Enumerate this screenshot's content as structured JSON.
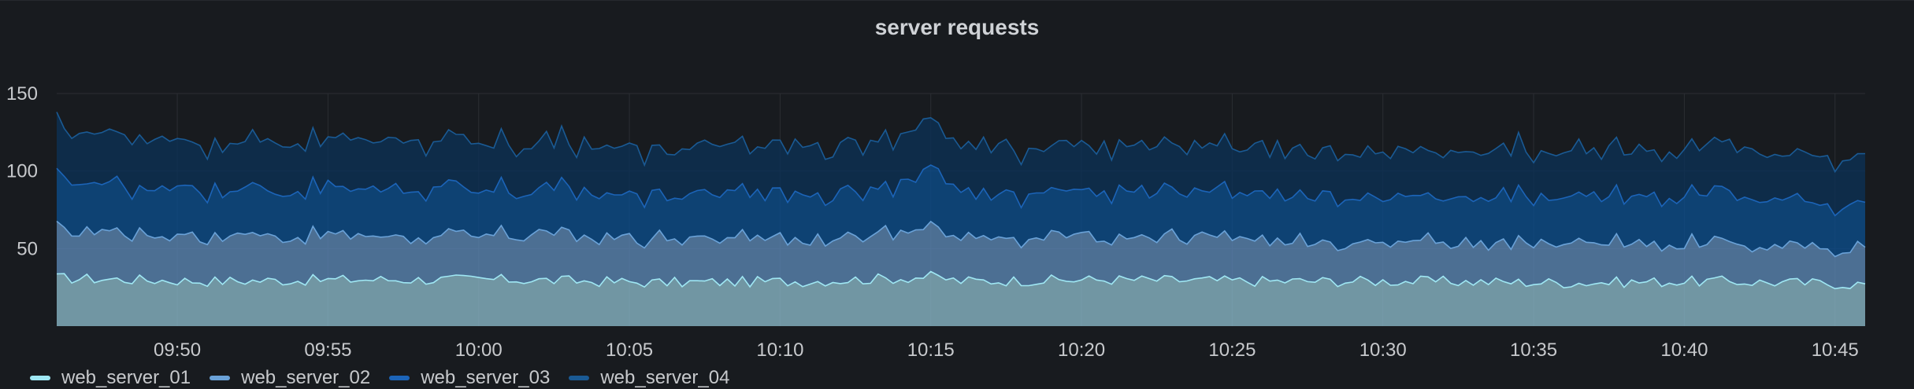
{
  "panel": {
    "title": "server requests"
  },
  "chart_data": {
    "type": "area",
    "stacked": true,
    "title": "server requests",
    "xlabel": "",
    "ylabel": "",
    "ylim": [
      0,
      150
    ],
    "yticks": [
      150,
      100,
      50
    ],
    "xrange": [
      "09:46",
      "10:46"
    ],
    "xticks": [
      "09:50",
      "09:55",
      "10:00",
      "10:05",
      "10:10",
      "10:15",
      "10:20",
      "10:25",
      "10:30",
      "10:35",
      "10:40",
      "10:45"
    ],
    "grid": true,
    "legend_position": "bottom-left",
    "x": [
      "09:46",
      "09:51",
      "09:56",
      "10:01",
      "10:06",
      "10:11",
      "10:14",
      "10:15",
      "10:16",
      "10:21",
      "10:26",
      "10:31",
      "10:36",
      "10:41",
      "10:46"
    ],
    "series": [
      {
        "name": "web_server_01",
        "color": "#8ab8c9",
        "line": "#9fe7f3",
        "values": [
          31,
          29,
          30,
          30,
          28,
          29,
          31,
          32,
          29,
          30,
          29,
          29,
          28,
          29,
          27
        ]
      },
      {
        "name": "web_server_02",
        "color": "#5b86b5",
        "line": "#6aa2d8",
        "values": [
          31,
          30,
          28,
          29,
          28,
          28,
          31,
          35,
          27,
          28,
          26,
          25,
          26,
          25,
          23
        ]
      },
      {
        "name": "web_server_03",
        "color": "#0c4d8c",
        "line": "#1c64b8",
        "values": [
          31,
          30,
          30,
          29,
          29,
          28,
          30,
          38,
          28,
          29,
          30,
          29,
          30,
          31,
          28
        ]
      },
      {
        "name": "web_server_04",
        "color": "#0b3156",
        "line": "#1a5a94",
        "values": [
          33,
          31,
          31,
          30,
          30,
          31,
          32,
          31,
          30,
          30,
          29,
          30,
          31,
          30,
          30
        ]
      }
    ]
  }
}
